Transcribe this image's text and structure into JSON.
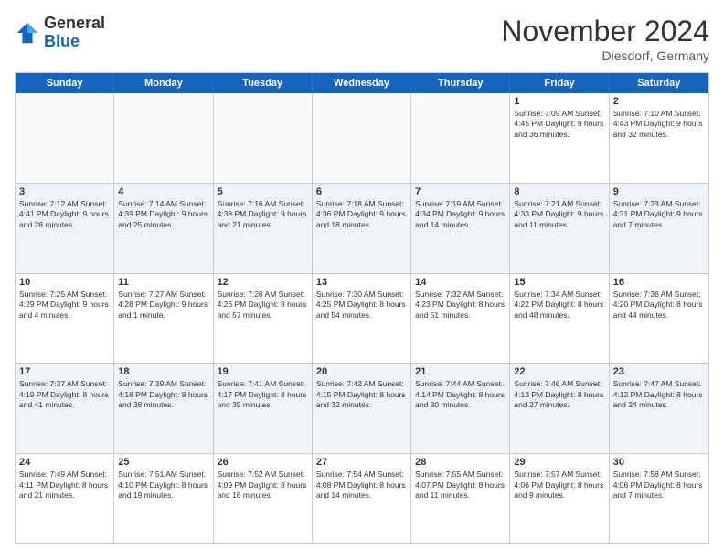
{
  "logo": {
    "general": "General",
    "blue": "Blue"
  },
  "header": {
    "month": "November 2024",
    "location": "Diesdorf, Germany"
  },
  "weekdays": [
    "Sunday",
    "Monday",
    "Tuesday",
    "Wednesday",
    "Thursday",
    "Friday",
    "Saturday"
  ],
  "rows": [
    [
      {
        "day": "",
        "text": "",
        "empty": true
      },
      {
        "day": "",
        "text": "",
        "empty": true
      },
      {
        "day": "",
        "text": "",
        "empty": true
      },
      {
        "day": "",
        "text": "",
        "empty": true
      },
      {
        "day": "",
        "text": "",
        "empty": true
      },
      {
        "day": "1",
        "text": "Sunrise: 7:09 AM\nSunset: 4:45 PM\nDaylight: 9 hours\nand 36 minutes.",
        "empty": false
      },
      {
        "day": "2",
        "text": "Sunrise: 7:10 AM\nSunset: 4:43 PM\nDaylight: 9 hours\nand 32 minutes.",
        "empty": false
      }
    ],
    [
      {
        "day": "3",
        "text": "Sunrise: 7:12 AM\nSunset: 4:41 PM\nDaylight: 9 hours\nand 28 minutes.",
        "empty": false
      },
      {
        "day": "4",
        "text": "Sunrise: 7:14 AM\nSunset: 4:39 PM\nDaylight: 9 hours\nand 25 minutes.",
        "empty": false
      },
      {
        "day": "5",
        "text": "Sunrise: 7:16 AM\nSunset: 4:38 PM\nDaylight: 9 hours\nand 21 minutes.",
        "empty": false
      },
      {
        "day": "6",
        "text": "Sunrise: 7:18 AM\nSunset: 4:36 PM\nDaylight: 9 hours\nand 18 minutes.",
        "empty": false
      },
      {
        "day": "7",
        "text": "Sunrise: 7:19 AM\nSunset: 4:34 PM\nDaylight: 9 hours\nand 14 minutes.",
        "empty": false
      },
      {
        "day": "8",
        "text": "Sunrise: 7:21 AM\nSunset: 4:33 PM\nDaylight: 9 hours\nand 11 minutes.",
        "empty": false
      },
      {
        "day": "9",
        "text": "Sunrise: 7:23 AM\nSunset: 4:31 PM\nDaylight: 9 hours\nand 7 minutes.",
        "empty": false
      }
    ],
    [
      {
        "day": "10",
        "text": "Sunrise: 7:25 AM\nSunset: 4:29 PM\nDaylight: 9 hours\nand 4 minutes.",
        "empty": false
      },
      {
        "day": "11",
        "text": "Sunrise: 7:27 AM\nSunset: 4:28 PM\nDaylight: 9 hours\nand 1 minute.",
        "empty": false
      },
      {
        "day": "12",
        "text": "Sunrise: 7:28 AM\nSunset: 4:26 PM\nDaylight: 8 hours\nand 57 minutes.",
        "empty": false
      },
      {
        "day": "13",
        "text": "Sunrise: 7:30 AM\nSunset: 4:25 PM\nDaylight: 8 hours\nand 54 minutes.",
        "empty": false
      },
      {
        "day": "14",
        "text": "Sunrise: 7:32 AM\nSunset: 4:23 PM\nDaylight: 8 hours\nand 51 minutes.",
        "empty": false
      },
      {
        "day": "15",
        "text": "Sunrise: 7:34 AM\nSunset: 4:22 PM\nDaylight: 8 hours\nand 48 minutes.",
        "empty": false
      },
      {
        "day": "16",
        "text": "Sunrise: 7:36 AM\nSunset: 4:20 PM\nDaylight: 8 hours\nand 44 minutes.",
        "empty": false
      }
    ],
    [
      {
        "day": "17",
        "text": "Sunrise: 7:37 AM\nSunset: 4:19 PM\nDaylight: 8 hours\nand 41 minutes.",
        "empty": false
      },
      {
        "day": "18",
        "text": "Sunrise: 7:39 AM\nSunset: 4:18 PM\nDaylight: 8 hours\nand 38 minutes.",
        "empty": false
      },
      {
        "day": "19",
        "text": "Sunrise: 7:41 AM\nSunset: 4:17 PM\nDaylight: 8 hours\nand 35 minutes.",
        "empty": false
      },
      {
        "day": "20",
        "text": "Sunrise: 7:42 AM\nSunset: 4:15 PM\nDaylight: 8 hours\nand 32 minutes.",
        "empty": false
      },
      {
        "day": "21",
        "text": "Sunrise: 7:44 AM\nSunset: 4:14 PM\nDaylight: 8 hours\nand 30 minutes.",
        "empty": false
      },
      {
        "day": "22",
        "text": "Sunrise: 7:46 AM\nSunset: 4:13 PM\nDaylight: 8 hours\nand 27 minutes.",
        "empty": false
      },
      {
        "day": "23",
        "text": "Sunrise: 7:47 AM\nSunset: 4:12 PM\nDaylight: 8 hours\nand 24 minutes.",
        "empty": false
      }
    ],
    [
      {
        "day": "24",
        "text": "Sunrise: 7:49 AM\nSunset: 4:11 PM\nDaylight: 8 hours\nand 21 minutes.",
        "empty": false
      },
      {
        "day": "25",
        "text": "Sunrise: 7:51 AM\nSunset: 4:10 PM\nDaylight: 8 hours\nand 19 minutes.",
        "empty": false
      },
      {
        "day": "26",
        "text": "Sunrise: 7:52 AM\nSunset: 4:09 PM\nDaylight: 8 hours\nand 16 minutes.",
        "empty": false
      },
      {
        "day": "27",
        "text": "Sunrise: 7:54 AM\nSunset: 4:08 PM\nDaylight: 8 hours\nand 14 minutes.",
        "empty": false
      },
      {
        "day": "28",
        "text": "Sunrise: 7:55 AM\nSunset: 4:07 PM\nDaylight: 8 hours\nand 11 minutes.",
        "empty": false
      },
      {
        "day": "29",
        "text": "Sunrise: 7:57 AM\nSunset: 4:06 PM\nDaylight: 8 hours\nand 9 minutes.",
        "empty": false
      },
      {
        "day": "30",
        "text": "Sunrise: 7:58 AM\nSunset: 4:06 PM\nDaylight: 8 hours\nand 7 minutes.",
        "empty": false
      }
    ]
  ]
}
